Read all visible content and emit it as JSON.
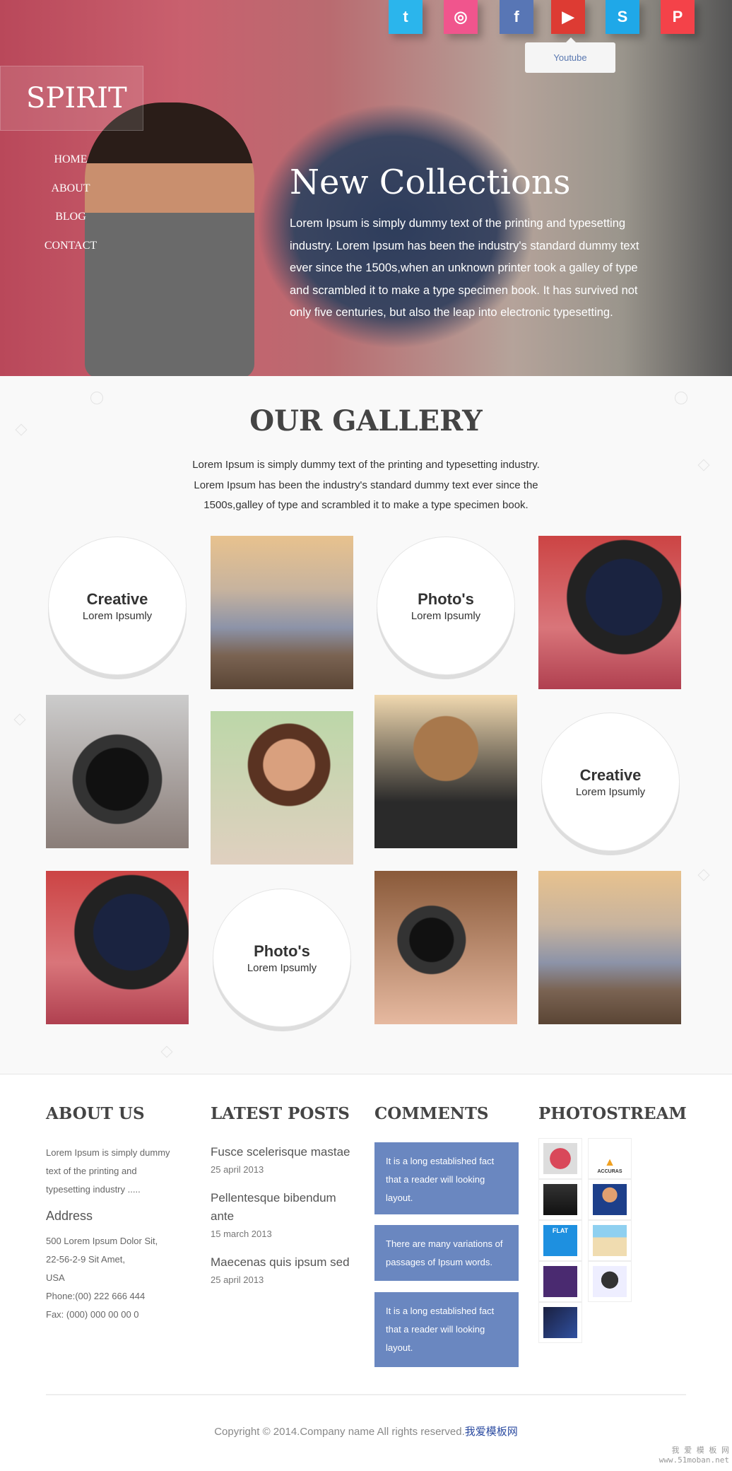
{
  "social": [
    {
      "name": "twitter",
      "glyph": "t",
      "color": "#2bb5ec"
    },
    {
      "name": "dribbble",
      "glyph": "◎",
      "color": "#f0558d"
    },
    {
      "name": "facebook",
      "glyph": "f",
      "color": "#5876b5"
    },
    {
      "name": "youtube",
      "glyph": "▶",
      "color": "#dd3b33"
    },
    {
      "name": "skype",
      "glyph": "S",
      "color": "#1fa8e8"
    },
    {
      "name": "pinterest",
      "glyph": "P",
      "color": "#f44249"
    }
  ],
  "tooltip": "Youtube",
  "logo": "SPIRIT",
  "nav": [
    "HOME",
    "ABOUT",
    "BLOG",
    "CONTACT"
  ],
  "hero": {
    "title": "New Collections",
    "text": "Lorem Ipsum is simply dummy text of the printing and typesetting industry. Lorem Ipsum has been the industry's standard dummy text ever since the 1500s,when an unknown printer took a galley of type and scrambled it to make a type specimen book. It has survived not only five centuries, but also the leap into electronic typesetting."
  },
  "gallery": {
    "title": "OUR GALLERY",
    "text": "Lorem Ipsum is simply dummy text of the printing and typesetting industry. Lorem Ipsum has been the industry's standard dummy text ever since the 1500s,galley of type and scrambled it to make a type specimen book.",
    "circles": [
      {
        "title": "Creative",
        "sub": "Lorem Ipsumly"
      },
      {
        "title": "Photo's",
        "sub": "Lorem Ipsumly"
      },
      {
        "title": "Creative",
        "sub": "Lorem Ipsumly"
      },
      {
        "title": "Photo's",
        "sub": "Lorem Ipsumly"
      }
    ]
  },
  "footer": {
    "about": {
      "heading": "ABOUT US",
      "text": "Lorem Ipsum is simply dummy text of the printing and typesetting industry .....",
      "address_heading": "Address",
      "address": [
        "500 Lorem Ipsum Dolor Sit,",
        "22-56-2-9 Sit Amet,",
        "USA",
        "Phone:(00) 222 666 444",
        "Fax: (000) 000 00 00 0"
      ]
    },
    "posts": {
      "heading": "LATEST POSTS",
      "items": [
        {
          "title": "Fusce scelerisque mastae",
          "date": "25 april 2013"
        },
        {
          "title": "Pellentesque bibendum ante",
          "date": "15 march 2013"
        },
        {
          "title": "Maecenas quis ipsum sed",
          "date": "25 april 2013"
        }
      ]
    },
    "comments": {
      "heading": "COMMENTS",
      "items": [
        "It is a long established fact that a reader will looking layout.",
        "There are many variations of passages of Ipsum words.",
        "It is a long established fact that a reader will looking layout."
      ],
      "color": "#6a87c0"
    },
    "photostream": {
      "heading": "PHOTOSTREAM",
      "thumb_labels": [
        "ACCURAS",
        "FLAT"
      ]
    },
    "copyright": "Copyright © 2014.Company name All rights reserved.",
    "copyright_link": "我爱模板网",
    "watermark": [
      "我 爱 模 板 网",
      "www.51moban.net"
    ]
  }
}
